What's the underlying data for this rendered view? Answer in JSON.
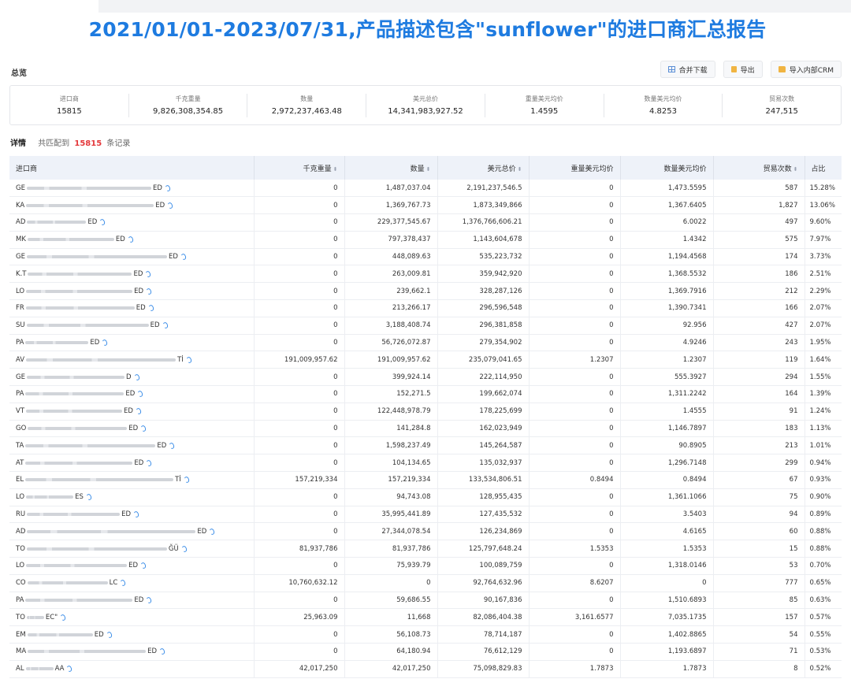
{
  "report": {
    "title": "2021/01/01-2023/07/31,产品描述包含\"sunflower\"的进口商汇总报告"
  },
  "overview": {
    "label": "总览",
    "buttons": [
      {
        "label": "合并下载",
        "icon": "grid-icon"
      },
      {
        "label": "导出",
        "icon": "file-icon"
      },
      {
        "label": "导入内部CRM",
        "icon": "folder-icon"
      }
    ],
    "stats": [
      {
        "label": "进口商",
        "value": "15815"
      },
      {
        "label": "千克重量",
        "value": "9,826,308,354.85"
      },
      {
        "label": "数量",
        "value": "2,972,237,463.48"
      },
      {
        "label": "美元总价",
        "value": "14,341,983,927.52"
      },
      {
        "label": "重量美元均价",
        "value": "1.4595"
      },
      {
        "label": "数量美元均价",
        "value": "4.8253"
      },
      {
        "label": "贸易次数",
        "value": "247,515"
      }
    ]
  },
  "detail": {
    "label": "详情",
    "prefix": "共匹配到",
    "count": "15815",
    "suffix": "条记录"
  },
  "table": {
    "columns": [
      {
        "label": "进口商",
        "sortable": false
      },
      {
        "label": "千克重量",
        "sortable": true
      },
      {
        "label": "数量",
        "sortable": true
      },
      {
        "label": "美元总价",
        "sortable": true
      },
      {
        "label": "重量美元均价",
        "sortable": false
      },
      {
        "label": "数量美元均价",
        "sortable": false
      },
      {
        "label": "贸易次数",
        "sortable": true
      },
      {
        "label": "占比",
        "sortable": false
      }
    ],
    "sort_glyph": "⬍",
    "rows": [
      {
        "name_start": "GE",
        "name_end": "ED",
        "blur": 158,
        "kg": "0",
        "qty": "1,487,037.04",
        "usd": "2,191,237,546.5",
        "kg_avg": "0",
        "qty_avg": "1,473.5595",
        "trades": "587",
        "share": "15.28%"
      },
      {
        "name_start": "KA",
        "name_end": "ED",
        "blur": 162,
        "kg": "0",
        "qty": "1,369,767.73",
        "usd": "1,873,349,866",
        "kg_avg": "0",
        "qty_avg": "1,367.6405",
        "trades": "1,827",
        "share": "13.06%"
      },
      {
        "name_start": "AD",
        "name_end": "ED",
        "blur": 75,
        "kg": "0",
        "qty": "229,377,545.67",
        "usd": "1,376,766,606.21",
        "kg_avg": "0",
        "qty_avg": "6.0022",
        "trades": "497",
        "share": "9.60%"
      },
      {
        "name_start": "MK",
        "name_end": "ED",
        "blur": 110,
        "kg": "0",
        "qty": "797,378,437",
        "usd": "1,143,604,678",
        "kg_avg": "0",
        "qty_avg": "1.4342",
        "trades": "575",
        "share": "7.97%"
      },
      {
        "name_start": "GE",
        "name_end": "ED",
        "blur": 178,
        "kg": "0",
        "qty": "448,089.63",
        "usd": "535,223,732",
        "kg_avg": "0",
        "qty_avg": "1,194.4568",
        "trades": "174",
        "share": "3.73%"
      },
      {
        "name_start": "K.T",
        "name_end": "ED",
        "blur": 132,
        "kg": "0",
        "qty": "263,009.81",
        "usd": "359,942,920",
        "kg_avg": "0",
        "qty_avg": "1,368.5532",
        "trades": "186",
        "share": "2.51%"
      },
      {
        "name_start": "LO",
        "name_end": "ED",
        "blur": 135,
        "kg": "0",
        "qty": "239,662.1",
        "usd": "328,287,126",
        "kg_avg": "0",
        "qty_avg": "1,369.7916",
        "trades": "212",
        "share": "2.29%"
      },
      {
        "name_start": "FR",
        "name_end": "ED",
        "blur": 138,
        "kg": "0",
        "qty": "213,266.17",
        "usd": "296,596,548",
        "kg_avg": "0",
        "qty_avg": "1,390.7341",
        "trades": "166",
        "share": "2.07%"
      },
      {
        "name_start": "SU",
        "name_end": "ED",
        "blur": 155,
        "kg": "0",
        "qty": "3,188,408.74",
        "usd": "296,381,858",
        "kg_avg": "0",
        "qty_avg": "92.956",
        "trades": "427",
        "share": "2.07%"
      },
      {
        "name_start": "PA",
        "name_end": "ED",
        "blur": 80,
        "kg": "0",
        "qty": "56,726,072.87",
        "usd": "279,354,902",
        "kg_avg": "0",
        "qty_avg": "4.9246",
        "trades": "243",
        "share": "1.95%"
      },
      {
        "name_start": "AV",
        "name_end": "Tİ",
        "blur": 190,
        "kg": "191,009,957.62",
        "qty": "191,009,957.62",
        "usd": "235,079,041.65",
        "kg_avg": "1.2307",
        "qty_avg": "1.2307",
        "trades": "119",
        "share": "1.64%"
      },
      {
        "name_start": "GE",
        "name_end": "D",
        "blur": 124,
        "kg": "0",
        "qty": "399,924.14",
        "usd": "222,114,950",
        "kg_avg": "0",
        "qty_avg": "555.3927",
        "trades": "294",
        "share": "1.55%"
      },
      {
        "name_start": "PA",
        "name_end": "ED",
        "blur": 125,
        "kg": "0",
        "qty": "152,271.5",
        "usd": "199,662,074",
        "kg_avg": "0",
        "qty_avg": "1,311.2242",
        "trades": "164",
        "share": "1.39%"
      },
      {
        "name_start": "VT",
        "name_end": "ED",
        "blur": 122,
        "kg": "0",
        "qty": "122,448,978.79",
        "usd": "178,225,699",
        "kg_avg": "0",
        "qty_avg": "1.4555",
        "trades": "91",
        "share": "1.24%"
      },
      {
        "name_start": "GO",
        "name_end": "ED",
        "blur": 126,
        "kg": "0",
        "qty": "141,284.8",
        "usd": "162,023,949",
        "kg_avg": "0",
        "qty_avg": "1,146.7897",
        "trades": "183",
        "share": "1.13%"
      },
      {
        "name_start": "TA",
        "name_end": "ED",
        "blur": 165,
        "kg": "0",
        "qty": "1,598,237.49",
        "usd": "145,264,587",
        "kg_avg": "0",
        "qty_avg": "90.8905",
        "trades": "213",
        "share": "1.01%"
      },
      {
        "name_start": "AT",
        "name_end": "ED",
        "blur": 136,
        "kg": "0",
        "qty": "104,134.65",
        "usd": "135,032,937",
        "kg_avg": "0",
        "qty_avg": "1,296.7148",
        "trades": "299",
        "share": "0.94%"
      },
      {
        "name_start": "EL",
        "name_end": "Tİ",
        "blur": 188,
        "kg": "157,219,334",
        "qty": "157,219,334",
        "usd": "133,534,806.51",
        "kg_avg": "0.8494",
        "qty_avg": "0.8494",
        "trades": "67",
        "share": "0.93%"
      },
      {
        "name_start": "LO",
        "name_end": "ES",
        "blur": 60,
        "kg": "0",
        "qty": "94,743.08",
        "usd": "128,955,435",
        "kg_avg": "0",
        "qty_avg": "1,361.1066",
        "trades": "75",
        "share": "0.90%"
      },
      {
        "name_start": "RU",
        "name_end": "ED",
        "blur": 118,
        "kg": "0",
        "qty": "35,995,441.89",
        "usd": "127,435,532",
        "kg_avg": "0",
        "qty_avg": "3.5403",
        "trades": "94",
        "share": "0.89%"
      },
      {
        "name_start": "AD",
        "name_end": "ED",
        "blur": 214,
        "kg": "0",
        "qty": "27,344,078.54",
        "usd": "126,234,869",
        "kg_avg": "0",
        "qty_avg": "4.6165",
        "trades": "60",
        "share": "0.88%"
      },
      {
        "name_start": "TO",
        "name_end": "ĞÜ",
        "blur": 178,
        "kg": "81,937,786",
        "qty": "81,937,786",
        "usd": "125,797,648.24",
        "kg_avg": "1.5353",
        "qty_avg": "1.5353",
        "trades": "15",
        "share": "0.88%"
      },
      {
        "name_start": "LO",
        "name_end": "ED",
        "blur": 128,
        "kg": "0",
        "qty": "75,939.79",
        "usd": "100,089,759",
        "kg_avg": "0",
        "qty_avg": "1,318.0146",
        "trades": "53",
        "share": "0.70%"
      },
      {
        "name_start": "CO",
        "name_end": "LC",
        "blur": 102,
        "kg": "10,760,632.12",
        "qty": "0",
        "usd": "92,764,632.96",
        "kg_avg": "8.6207",
        "qty_avg": "0",
        "trades": "777",
        "share": "0.65%"
      },
      {
        "name_start": "PA",
        "name_end": "ED",
        "blur": 136,
        "kg": "0",
        "qty": "59,686.55",
        "usd": "90,167,836",
        "kg_avg": "0",
        "qty_avg": "1,510.6893",
        "trades": "85",
        "share": "0.63%"
      },
      {
        "name_start": "TO",
        "name_end": "EC\"",
        "blur": 22,
        "kg": "25,963.09",
        "qty": "11,668",
        "usd": "82,086,404.38",
        "kg_avg": "3,161.6577",
        "qty_avg": "7,035.1735",
        "trades": "157",
        "share": "0.57%"
      },
      {
        "name_start": "EM",
        "name_end": "ED",
        "blur": 83,
        "kg": "0",
        "qty": "56,108.73",
        "usd": "78,714,187",
        "kg_avg": "0",
        "qty_avg": "1,402.8865",
        "trades": "54",
        "share": "0.55%"
      },
      {
        "name_start": "MA",
        "name_end": "ED",
        "blur": 150,
        "kg": "0",
        "qty": "64,180.94",
        "usd": "76,612,129",
        "kg_avg": "0",
        "qty_avg": "1,193.6897",
        "trades": "71",
        "share": "0.53%"
      },
      {
        "name_start": "AL",
        "name_end": "AA",
        "blur": 35,
        "kg": "42,017,250",
        "qty": "42,017,250",
        "usd": "75,098,829.83",
        "kg_avg": "1.7873",
        "qty_avg": "1.7873",
        "trades": "8",
        "share": "0.52%"
      }
    ]
  },
  "colors": {
    "title": "#1e7be0",
    "highlight_count": "#e4393c",
    "header_bg": "#eef2f9",
    "link_icon": "#3b8de8"
  }
}
